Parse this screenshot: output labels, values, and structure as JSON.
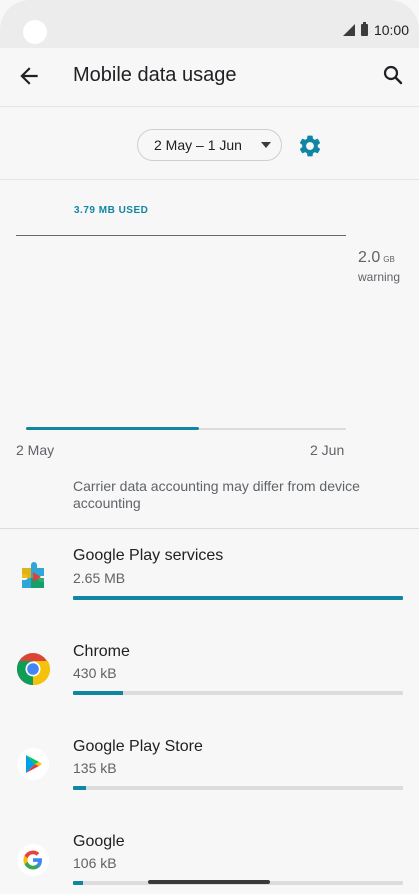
{
  "status_bar": {
    "time": "10:00"
  },
  "header": {
    "title": "Mobile data usage"
  },
  "cycle": {
    "label": "2 May – 1 Jun"
  },
  "chart": {
    "used_label": "3.79 MB USED",
    "warning_value": "2.0",
    "warning_unit": "GB",
    "warning_label": "warning",
    "x_start": "2 May",
    "x_end": "2 Jun",
    "used_fraction": 0.54
  },
  "note": "Carrier data accounting may differ from device accounting",
  "apps": [
    {
      "name": "Google Play services",
      "size": "2.65 MB",
      "fraction": 1.0,
      "icon": "play-services-icon"
    },
    {
      "name": "Chrome",
      "size": "430 kB",
      "fraction": 0.15,
      "icon": "chrome-icon"
    },
    {
      "name": "Google Play Store",
      "size": "135 kB",
      "fraction": 0.04,
      "icon": "play-store-icon"
    },
    {
      "name": "Google",
      "size": "106 kB",
      "fraction": 0.03,
      "icon": "google-icon"
    }
  ],
  "colors": {
    "accent": "#1186a2",
    "text": "#202124",
    "secondary": "#5f6368"
  }
}
